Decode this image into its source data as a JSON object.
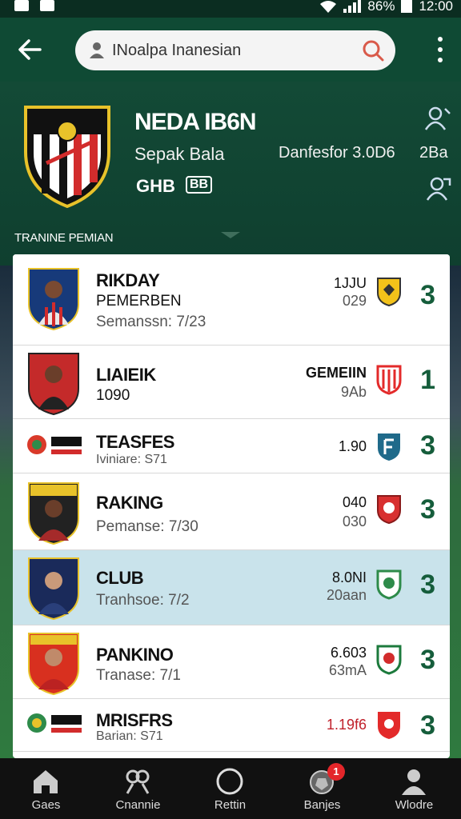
{
  "status_bar": {
    "battery": "86%",
    "time": "12:00"
  },
  "search": {
    "text": "INoalpa Inanesian"
  },
  "club": {
    "name": "NEDA IB6N",
    "subtitle": "Sepak Bala",
    "meta": "Danfesfor 3.0D6",
    "extra": "2Ba",
    "badge_a": "GHB",
    "badge_b": "BB"
  },
  "section_label": "TRANINE PEMIAN",
  "rows": [
    {
      "name": "RIKDAY",
      "sub1": "PEMERBEN",
      "sub2": "Semanssn: 7/23",
      "v1": "1JJU",
      "v2": "029",
      "rank": "3",
      "shield_color": "#f3c21a"
    },
    {
      "name": "LIAIEIK",
      "sub1": "1090",
      "sub2": "",
      "v1": "GEMEIIN",
      "v2": "9Ab",
      "rank": "1",
      "shield_color": "#e32a2a"
    },
    {
      "name": "TEASFES",
      "sub1": "",
      "sub2": "Iviniare: S71",
      "v1": "1.90",
      "v2": "",
      "rank": "3",
      "shield_color": "#1f6a8a"
    },
    {
      "name": "RAKING",
      "sub1": "",
      "sub2": "Pemanse: 7/30",
      "v1": "040",
      "v2": "030",
      "rank": "3",
      "shield_color": "#d83030"
    },
    {
      "name": "CLUB",
      "sub1": "",
      "sub2": "Tranhsoe: 7/2",
      "v1": "8.0NI",
      "v2": "20aan",
      "rank": "3",
      "shield_color": "#2e8b4a"
    },
    {
      "name": "PANKINO",
      "sub1": "",
      "sub2": "Tranase: 7/1",
      "v1": "6.603",
      "v2": "63mA",
      "rank": "3",
      "shield_color": "#1c7a3c"
    },
    {
      "name": "MRISFRS",
      "sub1": "",
      "sub2": "Barian: S71",
      "v1": "1.19f6",
      "v2": "",
      "rank": "3",
      "shield_color": "#e32a2a"
    }
  ],
  "bottom_nav": [
    {
      "label": "Gaes",
      "icon": "home-icon"
    },
    {
      "label": "Cnannie",
      "icon": "people-icon"
    },
    {
      "label": "Rettin",
      "icon": "circle-icon"
    },
    {
      "label": "Banjes",
      "icon": "ball-icon",
      "badge": "1"
    },
    {
      "label": "Wlodre",
      "icon": "profile-icon"
    }
  ],
  "colors": {
    "primary": "#0f4a34",
    "rank": "#155d3b",
    "highlight": "#c9e3eb",
    "notif": "#e3262a"
  }
}
